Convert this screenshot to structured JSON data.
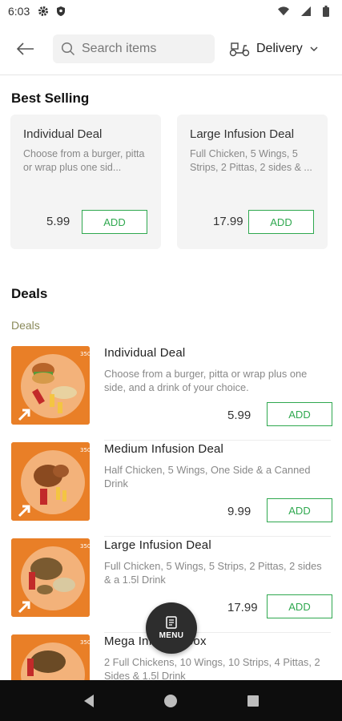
{
  "status_bar": {
    "time": "6:03"
  },
  "header": {
    "search_placeholder": "Search items",
    "delivery_label": "Delivery"
  },
  "best_selling": {
    "title": "Best Selling",
    "cards": [
      {
        "name": "Individual Deal",
        "desc": "Choose from a burger, pitta or wrap plus one sid...",
        "price": "5.99",
        "add_label": "ADD"
      },
      {
        "name": "Large Infusion Deal",
        "desc": "Full Chicken, 5 Wings, 5 Strips, 2 Pittas, 2 sides & ...",
        "price": "17.99",
        "add_label": "ADD"
      }
    ]
  },
  "deals": {
    "title": "Deals",
    "subtitle": "Deals",
    "items": [
      {
        "name": "Individual Deal",
        "desc": "Choose from a burger, pitta or wrap plus one side, and a drink of your choice.",
        "price": "5.99",
        "add_label": "ADD"
      },
      {
        "name": "Medium Infusion Deal",
        "desc": "Half Chicken, 5 Wings, One Side & a Canned Drink",
        "price": "9.99",
        "add_label": "ADD"
      },
      {
        "name": "Large Infusion Deal",
        "desc": "Full Chicken, 5 Wings, 5 Strips, 2 Pittas, 2 sides & a 1.5l Drink",
        "price": "17.99",
        "add_label": "ADD"
      },
      {
        "name": "Mega Infusion Box",
        "desc": "2 Full Chickens, 10 Wings, 10 Strips, 4 Pittas, 2 Sides & 1.5l Drink",
        "price": "",
        "add_label": ""
      }
    ]
  },
  "menu_fab": {
    "label": "MENU"
  },
  "colors": {
    "accent_green": "#2fa84f",
    "fab": "#2d2d2d",
    "deal_image_bg": "#e97f27"
  }
}
